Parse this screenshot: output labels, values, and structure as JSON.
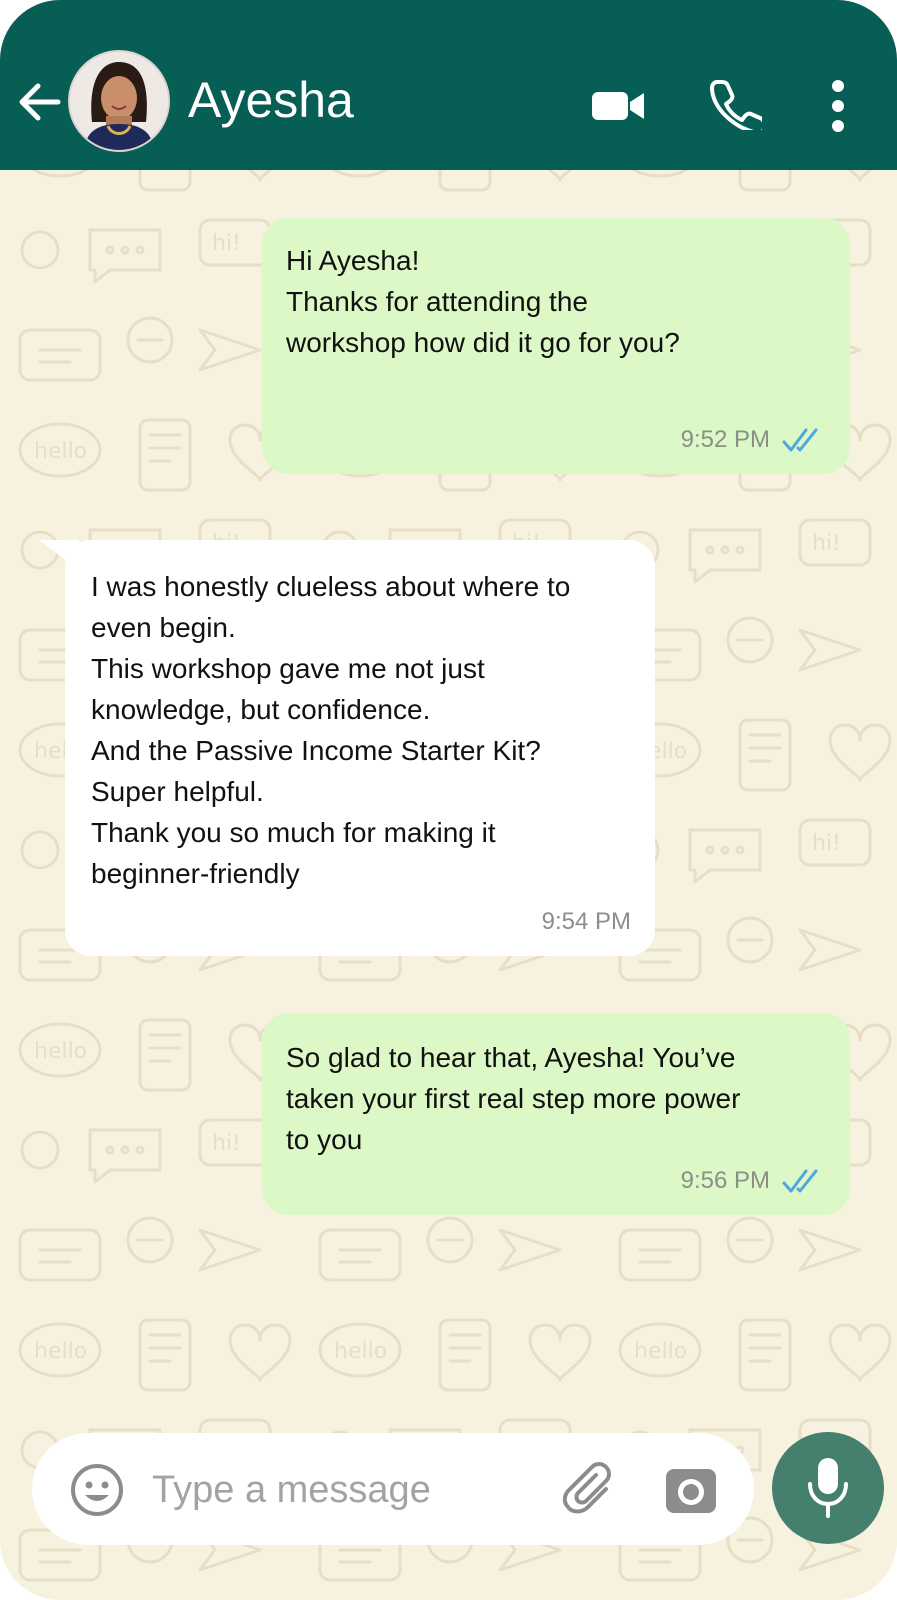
{
  "header": {
    "contact_name": "Ayesha",
    "icons": [
      "back-arrow-icon",
      "avatar",
      "video-camera-icon",
      "phone-icon",
      "more-options-icon"
    ]
  },
  "messages": [
    {
      "direction": "outgoing",
      "text": "Hi Ayesha!\nThanks for attending the\nworkshop how did it go for you?",
      "time": "9:52 PM",
      "status": "read"
    },
    {
      "direction": "incoming",
      "text": "I was honestly clueless about where to\neven begin.\nThis workshop gave me not just\nknowledge, but confidence.\nAnd the Passive Income Starter Kit?\nSuper helpful.\nThank you so much for making it\nbeginner-friendly",
      "time": "9:54 PM"
    },
    {
      "direction": "outgoing",
      "text": "So glad to hear that, Ayesha! You’ve\ntaken your first real step more power\nto you",
      "time": "9:56 PM",
      "status": "read"
    }
  ],
  "input_bar": {
    "placeholder": "Type a message",
    "icons": [
      "emoji-icon",
      "attachment-clip-icon",
      "camera-icon",
      "microphone-icon"
    ]
  },
  "colors": {
    "header": "#075e54",
    "wallpaper": "#f7f2df",
    "outgoing_bubble": "#dcf8c6",
    "incoming_bubble": "#ffffff",
    "read_ticks": "#4fa6e0",
    "mic_button": "#45806f"
  }
}
